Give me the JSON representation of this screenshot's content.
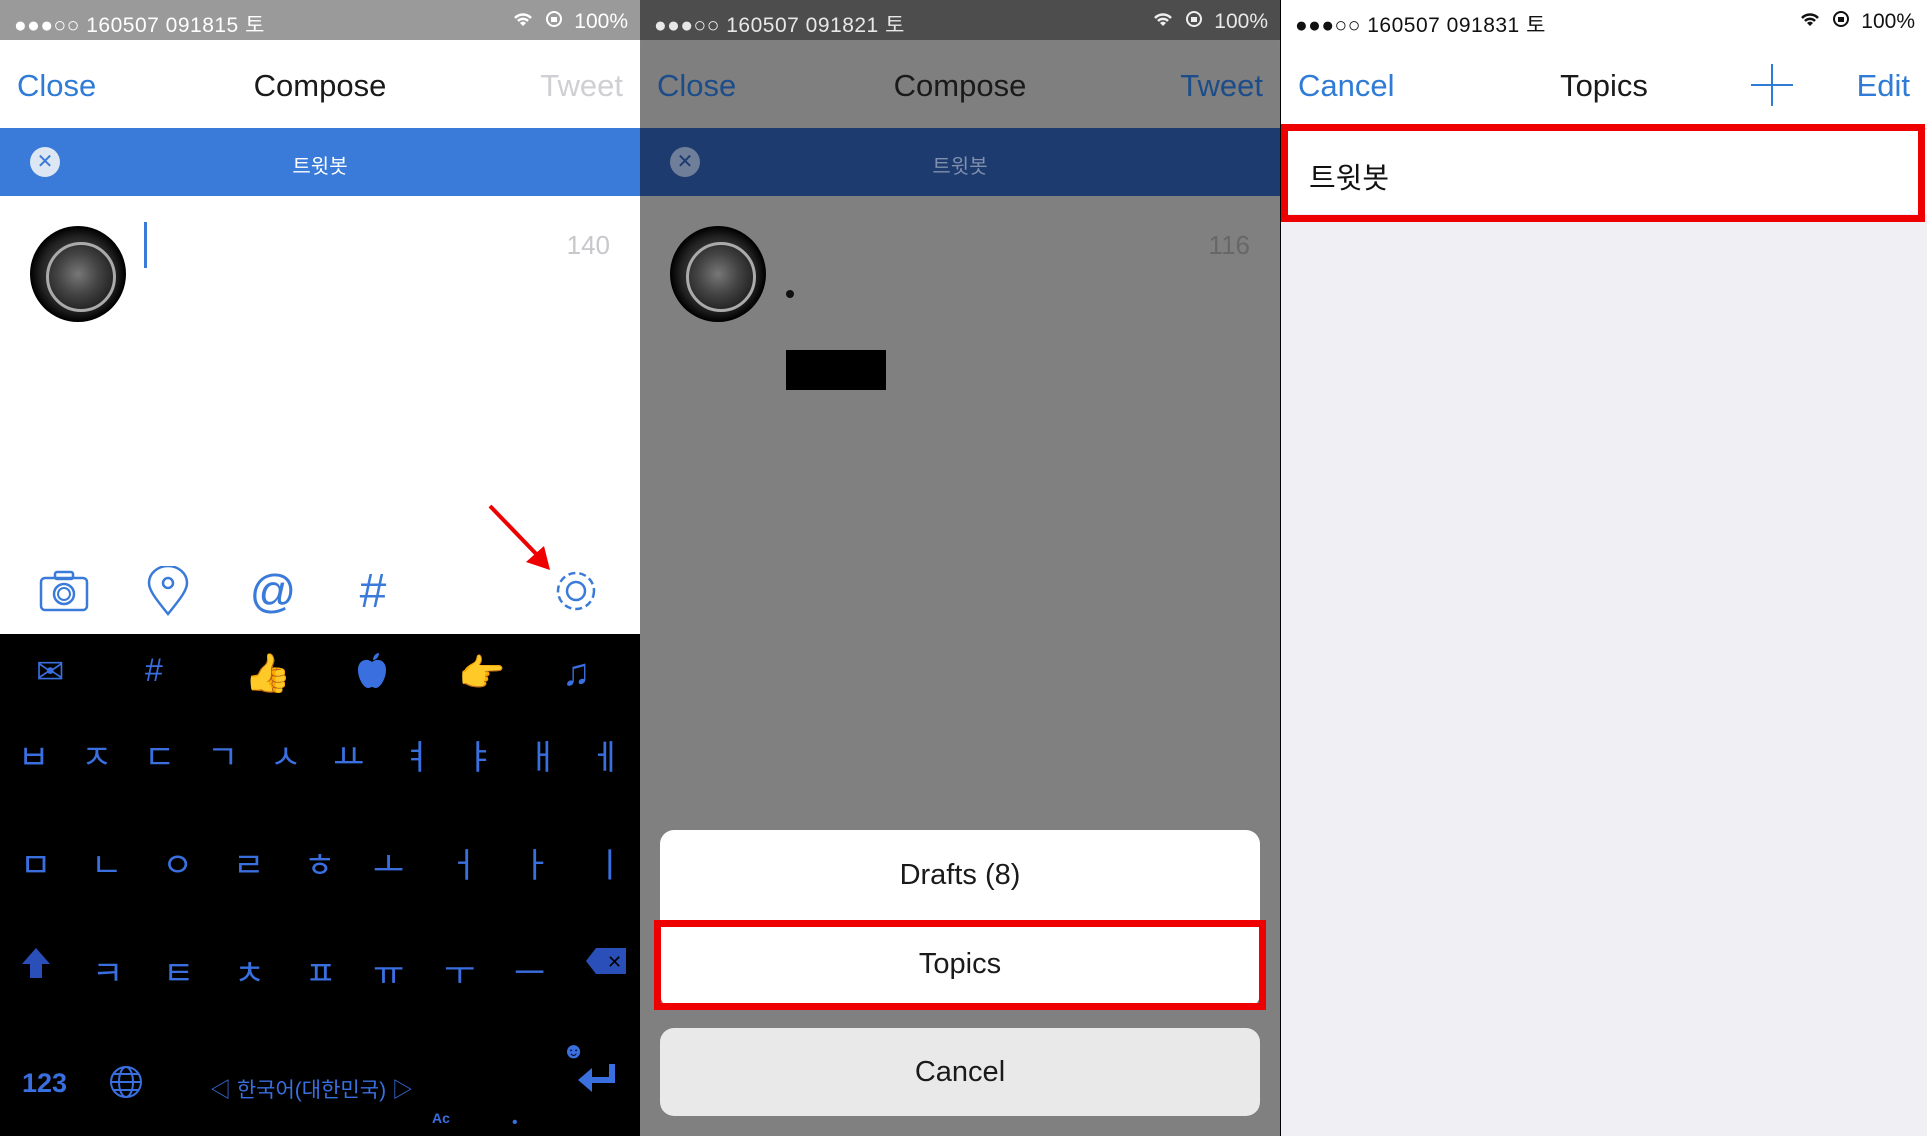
{
  "panel1": {
    "status": {
      "left": "●●●○○ 160507 091815 토",
      "battery": "100%"
    },
    "nav": {
      "left": "Close",
      "title": "Compose",
      "right": "Tweet"
    },
    "topic_bar": {
      "label": "트윗봇"
    },
    "char_count": "140",
    "toolbar": {
      "icons": [
        "camera-icon",
        "location-pin-icon",
        "mention-icon",
        "hashtag-icon",
        "gear-icon"
      ]
    },
    "keyboard": {
      "emoji_row": [
        "✉",
        "#",
        "👍",
        "",
        "👉",
        "♫"
      ],
      "row1": [
        "ㅂ",
        "ㅈ",
        "ㄷ",
        "ㄱ",
        "ㅅ",
        "ㅛ",
        "ㅕ",
        "ㅑ",
        "ㅐ",
        "ㅔ"
      ],
      "row2": [
        "ㅁ",
        "ㄴ",
        "ㅇ",
        "ㄹ",
        "ㅎ",
        "ㅗ",
        "ㅓ",
        "ㅏ",
        "ㅣ"
      ],
      "row3": [
        "ㅋ",
        "ㅌ",
        "ㅊ",
        "ㅍ",
        "ㅠ",
        "ㅜ",
        "ㅡ"
      ],
      "numbers_key": "123",
      "space_label": "◁ 한국어(대한민국) ▷"
    }
  },
  "panel2": {
    "status": {
      "left": "●●●○○ 160507 091821 토",
      "battery": "100%"
    },
    "nav": {
      "left": "Close",
      "title": "Compose",
      "right": "Tweet"
    },
    "topic_bar": {
      "label": "트윗봇"
    },
    "char_count": "116",
    "sheet": {
      "drafts": "Drafts (8)",
      "topics": "Topics",
      "cancel": "Cancel"
    }
  },
  "panel3": {
    "status": {
      "left": "●●●○○ 160507 091831 토",
      "battery": "100%"
    },
    "nav": {
      "left": "Cancel",
      "title": "Topics",
      "right": "Edit"
    },
    "topics": [
      "트윗봇"
    ]
  },
  "colors": {
    "accent": "#2f7bd6",
    "highlight": "#ee0000",
    "topic_bar": "#3a7ad9"
  }
}
